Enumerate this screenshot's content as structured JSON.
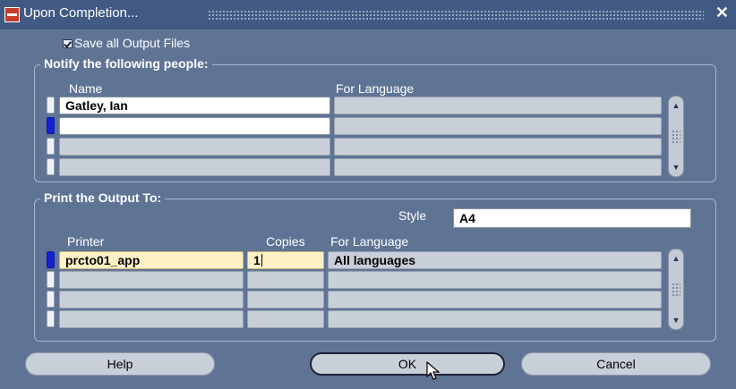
{
  "window": {
    "title": "Upon Completion...",
    "close_glyph": "✕",
    "app_icon": "oracle-forms-icon"
  },
  "save_all": {
    "label": "Save all Output Files",
    "checked": true
  },
  "notify": {
    "group_title": "Notify the following people:",
    "columns": [
      "Name",
      "For Language"
    ],
    "rows": [
      {
        "name": "Gatley, Ian",
        "language": ""
      },
      {
        "name": "",
        "language": ""
      },
      {
        "name": "",
        "language": ""
      },
      {
        "name": "",
        "language": ""
      }
    ]
  },
  "print": {
    "group_title": "Print the Output To:",
    "style_label": "Style",
    "style_value": "A4",
    "columns": [
      "Printer",
      "Copies",
      "For Language"
    ],
    "rows": [
      {
        "printer": "prcto01_app",
        "copies": "1",
        "language": "All languages"
      },
      {
        "printer": "",
        "copies": "",
        "language": ""
      },
      {
        "printer": "",
        "copies": "",
        "language": ""
      },
      {
        "printer": "",
        "copies": "",
        "language": ""
      }
    ]
  },
  "buttons": {
    "help": "Help",
    "ok": "OK",
    "cancel": "Cancel"
  },
  "colors": {
    "background": "#5f7495",
    "titlebar": "#415a84",
    "current_record": "#1420d6",
    "active_field": "#fff1c6"
  }
}
